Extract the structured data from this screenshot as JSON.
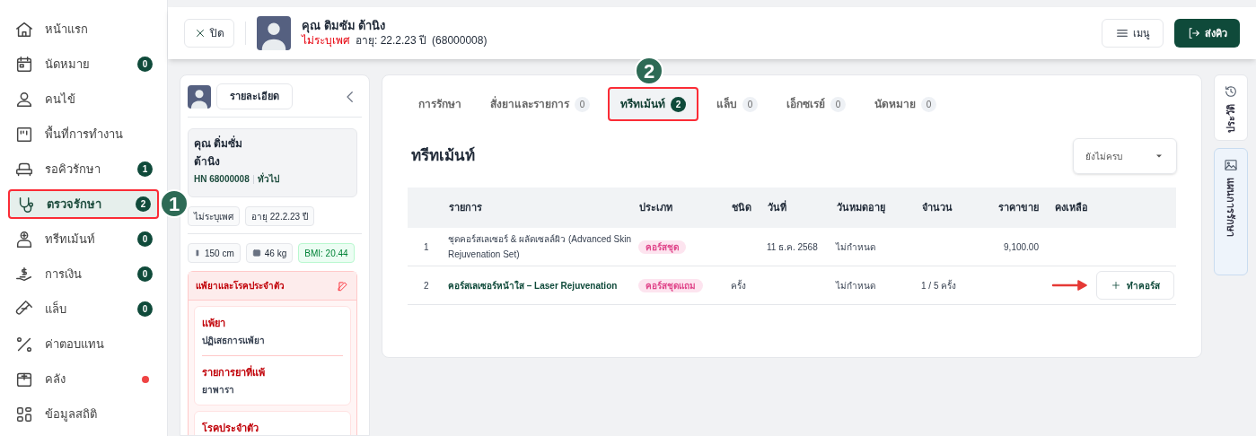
{
  "sidebar": {
    "items": [
      {
        "label": "หน้าแรก",
        "selected": false
      },
      {
        "label": "นัดหมาย",
        "badge": "0",
        "selected": false
      },
      {
        "label": "คนไข้",
        "selected": false
      },
      {
        "label": "พื้นที่การทำงาน",
        "selected": false
      },
      {
        "label": "รอคิวรักษา",
        "badge": "1",
        "selected": false
      },
      {
        "label": "ตรวจรักษา",
        "badge": "2",
        "selected": true,
        "callout": "1"
      },
      {
        "label": "ทรีทเม้นท์",
        "badge": "0",
        "selected": false
      },
      {
        "label": "การเงิน",
        "badge": "0",
        "selected": false
      },
      {
        "label": "แล็บ",
        "badge": "0",
        "selected": false
      },
      {
        "label": "ค่าตอบแทน",
        "selected": false
      },
      {
        "label": "คลัง",
        "color": "#ef4444",
        "selected": false
      },
      {
        "label": "ข้อมูลสถิติ",
        "selected": false
      }
    ]
  },
  "header": {
    "close_label": "ปิด",
    "patient_name": "คุณ ติมซัม ต้านิง",
    "gender": "ไม่ระบุเพศ",
    "age": "อายุ: 22.2.23 ปี",
    "hn": "(68000008)",
    "menu_label": "เมนู",
    "send_label": "ส่งคิว"
  },
  "patient_panel": {
    "details_label": "รายละเอียด",
    "name_lines": [
      "คุณ ติ่มซั่ม",
      "ต้านิง"
    ],
    "hn": "HN 68000008",
    "group": "ทั่วไป",
    "tags": [
      "ไม่ระบุเพศ",
      "อายุ 22.2.23 ปี"
    ],
    "height": "150 cm",
    "weight": "46 kg",
    "bmi": "BMI: 20.44",
    "allergy_card": {
      "title": "แพ้ยาและโรคประจำตัว",
      "sections": [
        {
          "items": [
            {
              "label": "แพ้ยา",
              "value": "ปฏิเสธการแพ้ยา"
            },
            {
              "label": "รายการยาที่แพ้",
              "value": "ยาพารา"
            }
          ]
        },
        {
          "items": [
            {
              "label": "โรคประจำตัว"
            }
          ]
        }
      ]
    }
  },
  "tabs": [
    {
      "label": "การรักษา",
      "selected": false
    },
    {
      "label": "สั่งยาและรายการ",
      "count": "0",
      "selected": false
    },
    {
      "label": "ทรีทเม้นท์",
      "count": "2",
      "selected": true,
      "callout": "2"
    },
    {
      "label": "แล็บ",
      "count": "0",
      "selected": false
    },
    {
      "label": "เอ็กซเรย์",
      "count": "0",
      "selected": false
    },
    {
      "label": "นัดหมาย",
      "count": "0",
      "selected": false
    }
  ],
  "section_title": "ทรีทเม้นท์",
  "filter": {
    "value": "ยังไม่ครบ"
  },
  "table": {
    "columns": [
      "",
      "รายการ",
      "ประเภท",
      "ชนิด",
      "วันที่",
      "วันหมดอายุ",
      "จำนวน",
      "ราคาขาย",
      "คงเหลือ"
    ],
    "rows": [
      {
        "no": "1",
        "name": "ชุดคอร์สเลเซอร์ & ผลัดเซลล์ผิว (Advanced Skin Rejuvenation Set)",
        "emphasized": false,
        "type": "คอร์สชุด",
        "date": "11 ธ.ค. 2568",
        "expiry": "ไม่กำหนด",
        "price": "9,100.00"
      },
      {
        "no": "2",
        "name": "คอร์สเลเซอร์หน้าใส – Laser Rejuvenation",
        "emphasized": true,
        "type": "คอร์สชุดแถม",
        "kind": "ครั้ง",
        "expiry": "ไม่กำหนด",
        "quantity": "1 / 5 ครั้ง",
        "action": "ทำคอร์ส",
        "pointer_arrow": true
      }
    ]
  },
  "side_tabs": [
    {
      "label": "ประวัติ",
      "selected": false
    },
    {
      "label": "แผนการรักษา",
      "selected": true
    }
  ]
}
